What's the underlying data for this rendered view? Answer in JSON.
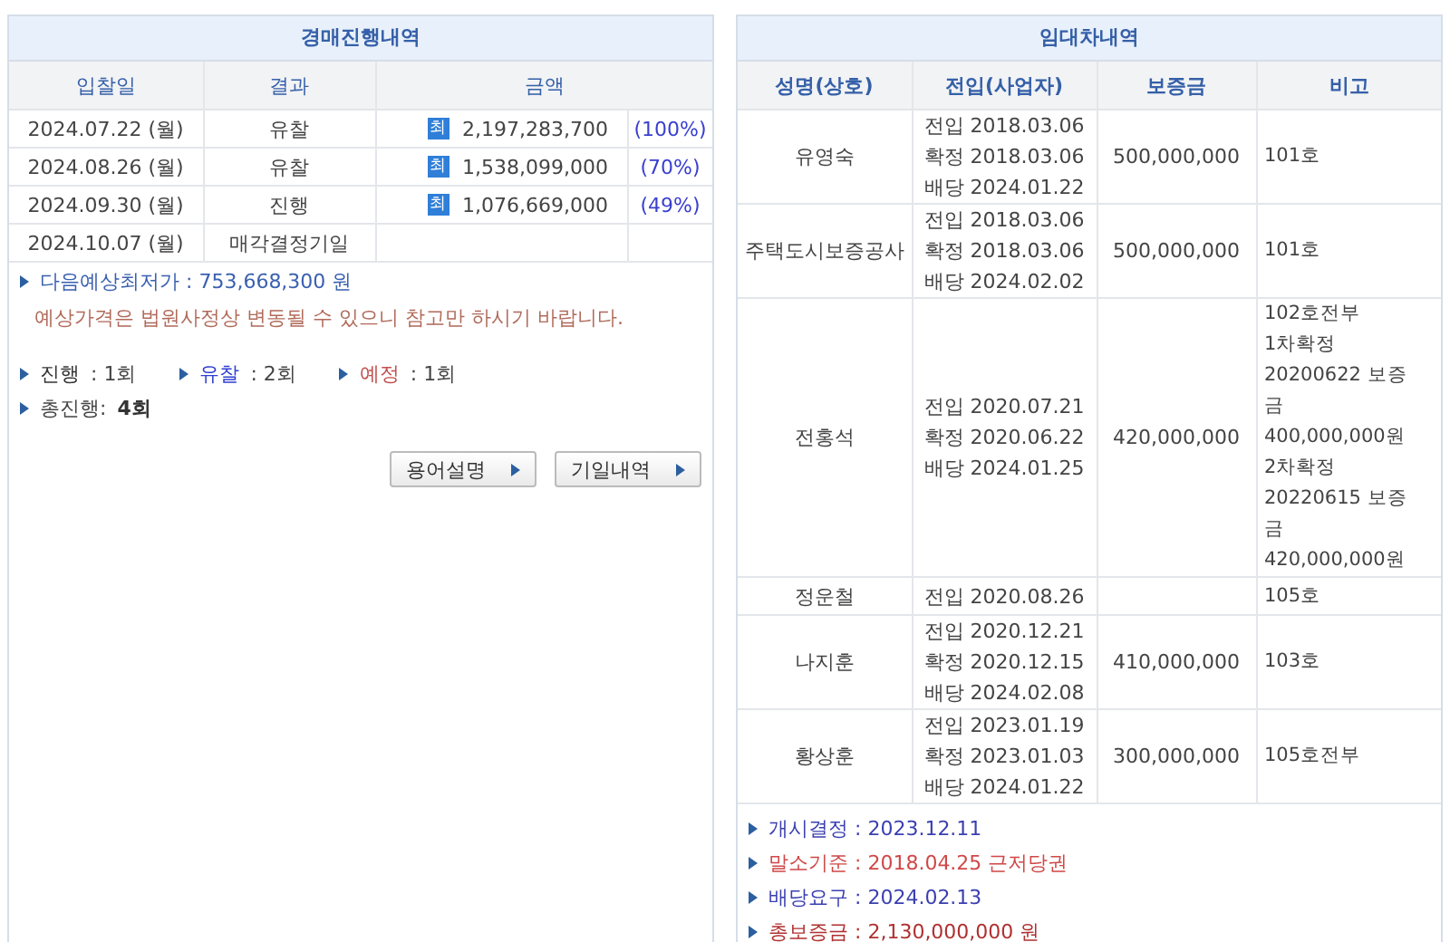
{
  "auction": {
    "title": "경매진행내역",
    "columns": [
      "입찰일",
      "결과",
      "금액"
    ],
    "rows": [
      {
        "date": "2024.07.22 (월)",
        "result": "유찰",
        "badge": "최",
        "amount": "2,197,283,700",
        "percent": "(100%)"
      },
      {
        "date": "2024.08.26 (월)",
        "result": "유찰",
        "badge": "최",
        "amount": "1,538,099,000",
        "percent": "(70%)"
      },
      {
        "date": "2024.09.30 (월)",
        "result": "진행",
        "badge": "최",
        "amount": "1,076,669,000",
        "percent": "(49%)"
      },
      {
        "date": "2024.10.07 (월)",
        "result": "매각결정기일"
      }
    ],
    "next_price": "다음예상최저가 : 753,668,300 원",
    "notice": "예상가격은 법원사정상 변동될 수 있으니 참고만 하시기 바랍니다.",
    "stats": [
      {
        "label": "진행",
        "value": ": 1회",
        "color": "#333333"
      },
      {
        "label": "유찰",
        "value": ": 2회",
        "color": "#2f3fd0"
      },
      {
        "label": "예정",
        "value": ": 1회",
        "color": "#c0504d"
      }
    ],
    "total_label": "총진행:",
    "total_value": "4회",
    "buttons": [
      "용어설명",
      "기일내역"
    ]
  },
  "tenants": {
    "title": "임대차내역",
    "columns": [
      "성명(상호)",
      "전입(사업자)",
      "보증금",
      "비고"
    ],
    "rows": [
      {
        "name": "유영숙",
        "dates": [
          "전입 2018.03.06",
          "확정 2018.03.06",
          "배당 2024.01.22"
        ],
        "deposit": "500,000,000",
        "note": [
          "101호"
        ]
      },
      {
        "name": "주택도시보증공사",
        "dates": [
          "전입 2018.03.06",
          "확정 2018.03.06",
          "배당 2024.02.02"
        ],
        "deposit": "500,000,000",
        "note": [
          "101호"
        ]
      },
      {
        "name": "전홍석",
        "dates": [
          "전입 2020.07.21",
          "확정 2020.06.22",
          "배당 2024.01.25"
        ],
        "deposit": "420,000,000",
        "note": [
          "102호전부",
          "1차확정",
          "20200622 보증",
          "금",
          "400,000,000원",
          "2차확정",
          "20220615 보증",
          "금",
          "420,000,000원"
        ]
      },
      {
        "name": "정운철",
        "dates": [
          "전입 2020.08.26"
        ],
        "note": [
          "105호"
        ]
      },
      {
        "name": "나지훈",
        "dates": [
          "전입 2020.12.21",
          "확정 2020.12.15",
          "배당 2024.02.08"
        ],
        "deposit": "410,000,000",
        "note": [
          "103호"
        ]
      },
      {
        "name": "황상훈",
        "dates": [
          "전입 2023.01.19",
          "확정 2023.01.03",
          "배당 2024.01.22"
        ],
        "deposit": "300,000,000",
        "note": [
          "105호전부"
        ]
      }
    ],
    "info": [
      {
        "text": "개시결정 : 2023.12.11",
        "color": "#3a3fb0"
      },
      {
        "text": "말소기준 : 2018.04.25 근저당권",
        "color": "#d04848"
      },
      {
        "text": "배당요구 : 2024.02.13",
        "color": "#3a3fb0"
      },
      {
        "text": "총보증금 : 2,130,000,000 원",
        "color": "#b03030"
      }
    ]
  }
}
